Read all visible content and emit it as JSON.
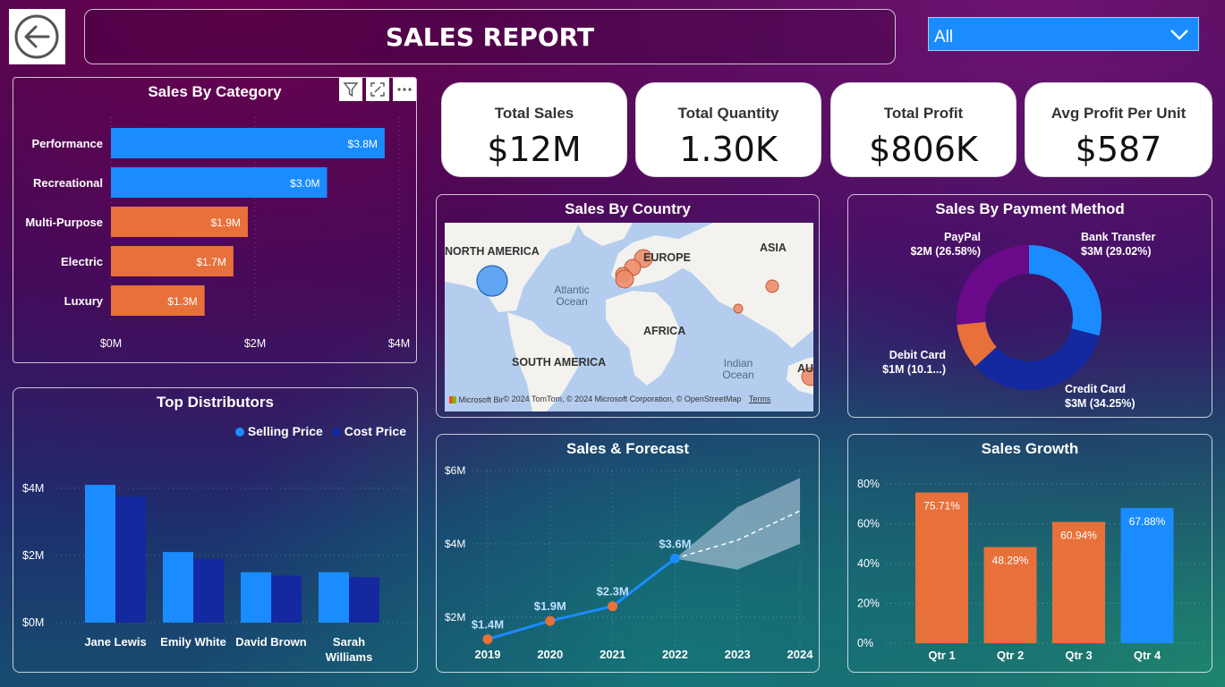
{
  "header": {
    "back_icon": "back-arrow-icon",
    "title": "SALES REPORT",
    "filter_value": "All"
  },
  "kpis": [
    {
      "label": "Total Sales",
      "value": "$12M"
    },
    {
      "label": "Total Quantity",
      "value": "1.30K"
    },
    {
      "label": "Total Profit",
      "value": "$806K"
    },
    {
      "label": "Avg Profit Per Unit",
      "value": "$587"
    }
  ],
  "colors": {
    "blue": "#1a8cff",
    "orange": "#e8703a",
    "navy": "#1428a0",
    "purple": "#6a0a8a",
    "mapwater": "#b4cdef"
  },
  "category_chart": {
    "title": "Sales By Category",
    "toolbar_icons": [
      "filter-icon",
      "focus-mode-icon",
      "more-options-icon"
    ],
    "chart_data": {
      "type": "bar",
      "orientation": "horizontal",
      "categories": [
        "Performance",
        "Recreational",
        "Multi-Purpose",
        "Electric",
        "Luxury"
      ],
      "values": [
        3.8,
        3.0,
        1.9,
        1.7,
        1.3
      ],
      "labels": [
        "$3.8M",
        "$3.0M",
        "$1.9M",
        "$1.7M",
        "$1.3M"
      ],
      "bar_colors": [
        "#1a8cff",
        "#1a8cff",
        "#e8703a",
        "#e8703a",
        "#e8703a"
      ],
      "xlim": [
        0,
        4
      ],
      "xticks": [
        "$0M",
        "$2M",
        "$4M"
      ]
    }
  },
  "distributors_chart": {
    "title": "Top Distributors",
    "chart_data": {
      "type": "bar",
      "categories": [
        "Jane Lewis",
        "Emily White",
        "David Brown",
        "Sarah Williams"
      ],
      "series": [
        {
          "name": "Selling Price",
          "color": "#1a8cff",
          "values": [
            4.1,
            2.1,
            1.5,
            1.5
          ]
        },
        {
          "name": "Cost Price",
          "color": "#1428a0",
          "values": [
            3.75,
            1.9,
            1.4,
            1.35
          ]
        }
      ],
      "ylim": [
        0,
        4.5
      ],
      "yticks": [
        "$0M",
        "$2M",
        "$4M"
      ]
    }
  },
  "country_map": {
    "title": "Sales By Country",
    "continent_labels": [
      "NORTH AMERICA",
      "EUROPE",
      "ASIA",
      "AFRICA",
      "SOUTH AMERICA",
      "Atlantic Ocean",
      "Indian Ocean",
      "AUS"
    ],
    "attribution": "© 2024 TomTom, © 2024 Microsoft Corporation, © OpenStreetMap",
    "terms": "Terms",
    "brand": "Microsoft Bing"
  },
  "payment_chart": {
    "title": "Sales By Payment Method",
    "chart_data": {
      "type": "pie",
      "donut": true,
      "slices": [
        {
          "name": "Bank Transfer",
          "label": "$3M (29.02%)",
          "percent": 29.02,
          "color": "#1a8cff"
        },
        {
          "name": "Credit Card",
          "label": "$3M (34.25%)",
          "percent": 34.25,
          "color": "#1428a0"
        },
        {
          "name": "Debit Card",
          "label": "$1M (10.1...)",
          "percent": 10.15,
          "color": "#e8703a"
        },
        {
          "name": "PayPal",
          "label": "$2M (26.58%)",
          "percent": 26.58,
          "color": "#6a0a8a"
        }
      ]
    }
  },
  "forecast_chart": {
    "title": "Sales & Forecast",
    "chart_data": {
      "type": "line",
      "x": [
        "2019",
        "2020",
        "2021",
        "2022",
        "2023",
        "2024"
      ],
      "series": [
        {
          "values": [
            1.4,
            1.9,
            2.3,
            3.6
          ],
          "labels": [
            "$1.4M",
            "$1.9M",
            "$2.3M",
            "$3.6M"
          ],
          "color": "#1a8cff"
        }
      ],
      "forecast": {
        "x": [
          "2022",
          "2023",
          "2024"
        ],
        "values": [
          3.6,
          4.1,
          4.9
        ],
        "upper": [
          3.6,
          5.0,
          5.8
        ],
        "lower": [
          3.6,
          3.3,
          4.0
        ]
      },
      "ylim": [
        1,
        6
      ],
      "yticks": [
        "$2M",
        "$4M",
        "$6M"
      ]
    }
  },
  "growth_chart": {
    "title": "Sales Growth",
    "chart_data": {
      "type": "bar",
      "categories": [
        "Qtr 1",
        "Qtr 2",
        "Qtr 3",
        "Qtr 4"
      ],
      "values": [
        75.71,
        48.29,
        60.94,
        67.88
      ],
      "labels": [
        "75.71%",
        "48.29%",
        "60.94%",
        "67.88%"
      ],
      "bar_colors": [
        "#e8703a",
        "#e8703a",
        "#e8703a",
        "#1a8cff"
      ],
      "ylim": [
        0,
        80
      ],
      "yticks": [
        "0%",
        "20%",
        "40%",
        "60%",
        "80%"
      ]
    }
  }
}
